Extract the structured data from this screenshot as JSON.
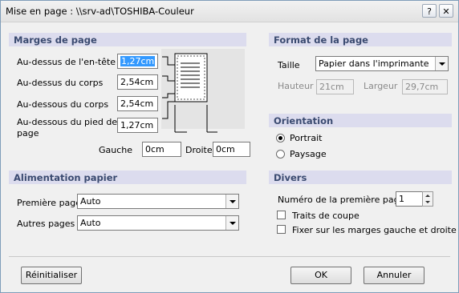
{
  "window": {
    "title": "Mise en page : \\\\srv-ad\\TOSHIBA-Couleur",
    "help_label": "?",
    "close_label": "✕"
  },
  "margins": {
    "heading": "Marges de page",
    "header_label": "Au-dessus de l'en-tête",
    "header_value": "1,27cm",
    "body_top_label": "Au-dessus du corps",
    "body_top_value": "2,54cm",
    "body_bottom_label": "Au-dessous du corps",
    "body_bottom_value": "2,54cm",
    "footer_label_line1": "Au-dessous du pied de",
    "footer_label_line2": "page",
    "footer_value": "1,27cm",
    "left_label": "Gauche",
    "left_value": "0cm",
    "right_label": "Droite",
    "right_value": "0cm"
  },
  "format": {
    "heading": "Format de la page",
    "size_label": "Taille",
    "size_value": "Papier dans l'imprimante",
    "height_label": "Hauteur",
    "height_value": "21cm",
    "width_label": "Largeur",
    "width_value": "29,7cm"
  },
  "orientation": {
    "heading": "Orientation",
    "portrait_label": "Portrait",
    "landscape_label": "Paysage",
    "selected": "Portrait"
  },
  "feed": {
    "heading": "Alimentation papier",
    "first_label": "Première page",
    "first_value": "Auto",
    "other_label": "Autres pages",
    "other_value": "Auto"
  },
  "misc": {
    "heading": "Divers",
    "first_page_number_label": "Numéro de la première page",
    "first_page_number_value": "1",
    "crop_marks_label": "Traits de coupe",
    "crop_marks_checked": false,
    "fix_margins_label": "Fixer sur les marges gauche et droite",
    "fix_margins_checked": false
  },
  "buttons": {
    "reset": "Réinitialiser",
    "ok": "OK",
    "cancel": "Annuler"
  }
}
